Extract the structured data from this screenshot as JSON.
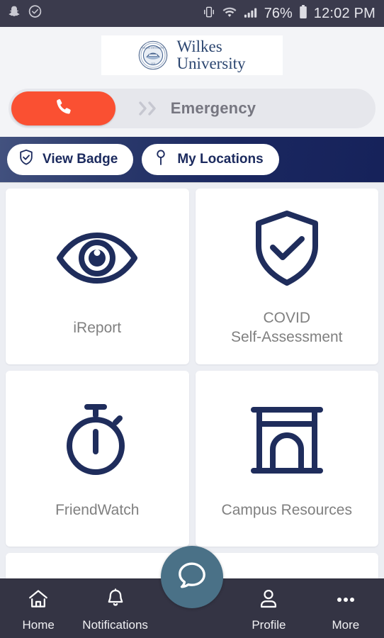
{
  "status_bar": {
    "left_icons": [
      "snapchat-icon",
      "clock-check-icon"
    ],
    "right_icons": [
      "vibrate-icon",
      "wifi-icon",
      "signal-icon",
      "battery-icon"
    ],
    "battery_percent": "76%",
    "time": "12:02 PM"
  },
  "header": {
    "logo_line1": "Wilkes",
    "logo_line2": "University",
    "seal_icon": "university-seal-icon"
  },
  "emergency": {
    "call_icon": "phone-icon",
    "chevrons": "»",
    "label": "Emergency"
  },
  "action_bar": {
    "buttons": [
      {
        "label": "View Badge",
        "icon": "shield-check-icon"
      },
      {
        "label": "My Locations",
        "icon": "map-pin-icon"
      }
    ]
  },
  "cards": [
    {
      "label": "iReport",
      "icon": "eye-icon"
    },
    {
      "label_line1": "COVID",
      "label_line2": "Self-Assessment",
      "icon": "shield-check-icon"
    },
    {
      "label": "FriendWatch",
      "icon": "stopwatch-icon"
    },
    {
      "label": "Campus Resources",
      "icon": "archway-icon"
    }
  ],
  "bottom_nav": {
    "items": [
      {
        "label": "Home",
        "icon": "home-icon"
      },
      {
        "label": "Notifications",
        "icon": "bell-icon"
      },
      {
        "label": "Profile",
        "icon": "person-icon"
      },
      {
        "label": "More",
        "icon": "ellipsis-icon"
      }
    ],
    "fab_icon": "chat-bubble-icon"
  },
  "colors": {
    "accent_orange": "#fa5032",
    "navy": "#1b2a5e",
    "status_bar": "#3b3b4d",
    "nav_bar": "#343444",
    "fab_teal": "#4a7187",
    "page_bg": "#eceef3",
    "label_gray": "#808080"
  }
}
